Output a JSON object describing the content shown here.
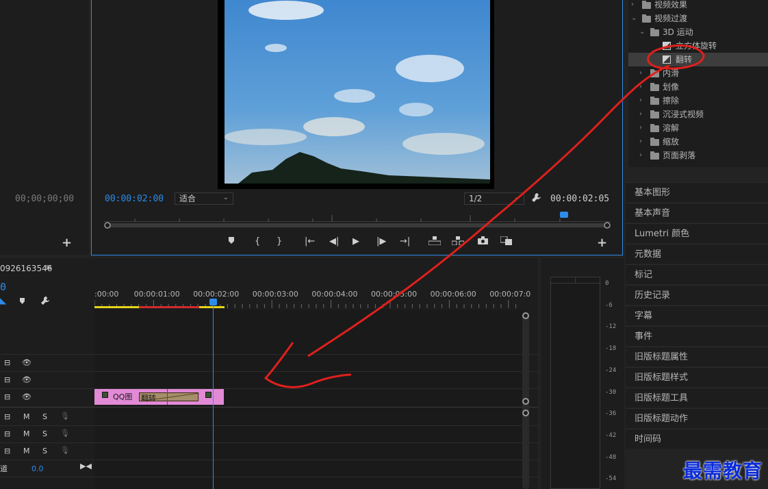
{
  "source": {
    "timecode": "00;00;00;00",
    "add_label": "+"
  },
  "program": {
    "timecode_current": "00:00:02:00",
    "fit_select": "适合",
    "resolution_select": "1/2",
    "timecode_duration": "00:00:02:05",
    "add_label": "+"
  },
  "effects_tree": [
    {
      "label": "视频效果",
      "level": 0,
      "type": "folder",
      "expanded": false
    },
    {
      "label": "视频过渡",
      "level": 0,
      "type": "folder",
      "expanded": true
    },
    {
      "label": "3D 运动",
      "level": 1,
      "type": "folder",
      "expanded": true
    },
    {
      "label": "立方体旋转",
      "level": 2,
      "type": "effect"
    },
    {
      "label": "翻转",
      "level": 2,
      "type": "effect",
      "selected": true
    },
    {
      "label": "内滑",
      "level": 1,
      "type": "folder",
      "expanded": false
    },
    {
      "label": "划像",
      "level": 1,
      "type": "folder",
      "expanded": false
    },
    {
      "label": "擦除",
      "level": 1,
      "type": "folder",
      "expanded": false
    },
    {
      "label": "沉浸式视频",
      "level": 1,
      "type": "folder",
      "expanded": false
    },
    {
      "label": "溶解",
      "level": 1,
      "type": "folder",
      "expanded": false
    },
    {
      "label": "缩放",
      "level": 1,
      "type": "folder",
      "expanded": false
    },
    {
      "label": "页面剥落",
      "level": 1,
      "type": "folder",
      "expanded": false
    }
  ],
  "side_panels": [
    "基本图形",
    "基本声音",
    "Lumetri 颜色",
    "元数据",
    "标记",
    "历史记录",
    "字幕",
    "事件",
    "旧版标题属性",
    "旧版标题样式",
    "旧版标题工具",
    "旧版标题动作",
    "时间码"
  ],
  "timeline": {
    "sequence_name": "0926163546",
    "timecode": "0",
    "ruler_labels": [
      ":00:00",
      "00:00:01:00",
      "00:00:02:00",
      "00:00:03:00",
      "00:00:04:00",
      "00:00:05:00",
      "00:00:06:00",
      "00:00:07:0"
    ],
    "clip_label": "QQ图",
    "transition_label": "翻转",
    "volume_label": "道",
    "volume_value": "0.0",
    "audio_buttons": {
      "mute": "M",
      "solo": "S"
    }
  },
  "meter_labels": [
    "0",
    "-6",
    "-12",
    "-18",
    "-24",
    "-30",
    "-36",
    "-42",
    "-48",
    "-54"
  ],
  "watermark": "最需教育",
  "colors": {
    "accent": "#2d8ceb",
    "clip": "#e28ad6",
    "annotation": "#e0201c"
  }
}
